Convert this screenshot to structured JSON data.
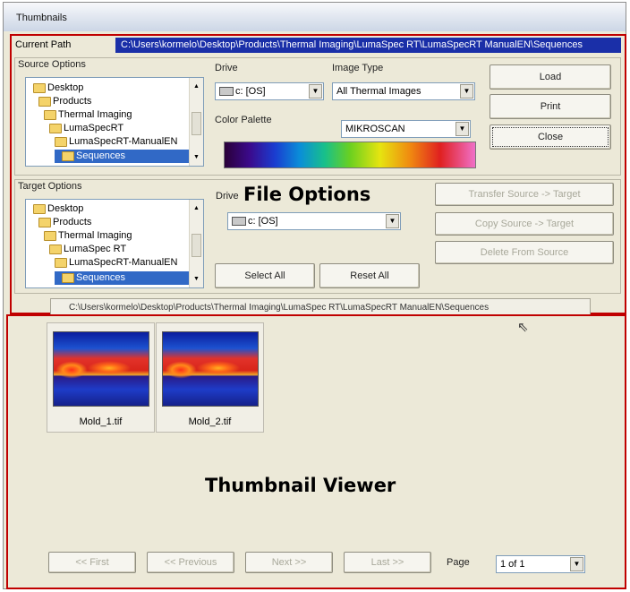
{
  "window": {
    "title": "Thumbnails"
  },
  "current_path": {
    "label": "Current Path",
    "value": "C:\\Users\\kormelo\\Desktop\\Products\\Thermal Imaging\\LumaSpec RT\\LumaSpecRT ManualEN\\Sequences"
  },
  "source": {
    "group_label": "Source Options",
    "tree": [
      "Desktop",
      "Products",
      "Thermal Imaging",
      "LumaSpecRT",
      "LumaSpecRT-ManualEN",
      "Sequences"
    ],
    "drive_label": "Drive",
    "drive_value": "c: [OS]",
    "image_type_label": "Image Type",
    "image_type_value": "All Thermal Images",
    "palette_label": "Color Palette",
    "palette_value": "MIKROSCAN"
  },
  "buttons": {
    "load": "Load",
    "print": "Print",
    "close": "Close"
  },
  "target": {
    "group_label": "Target Options",
    "tree": [
      "Desktop",
      "Products",
      "Thermal Imaging",
      "LumaSpec RT",
      "LumaSpecRT-ManualEN",
      "Sequences"
    ],
    "drive_label": "Drive",
    "drive_value": "c: [OS]",
    "select_all": "Select All",
    "reset_all": "Reset All",
    "transfer": "Transfer Source -> Target",
    "copy": "Copy Source -> Target",
    "delete": "Delete From Source"
  },
  "overlay": {
    "file_options": "File Options",
    "thumbnail_viewer": "Thumbnail Viewer"
  },
  "path_bar": "C:\\Users\\kormelo\\Desktop\\Products\\Thermal Imaging\\LumaSpec RT\\LumaSpecRT ManualEN\\Sequences",
  "thumbnails": [
    {
      "name": "Mold_1.tif"
    },
    {
      "name": "Mold_2.tif"
    }
  ],
  "pager": {
    "first": "<< First",
    "previous": "<< Previous",
    "next": "Next >>",
    "last": "Last >>",
    "page_label": "Page",
    "page_value": "1 of 1"
  },
  "colors": {
    "highlight": "#c00000",
    "selection": "#3169c6",
    "path_bg": "#1a2fa8"
  }
}
